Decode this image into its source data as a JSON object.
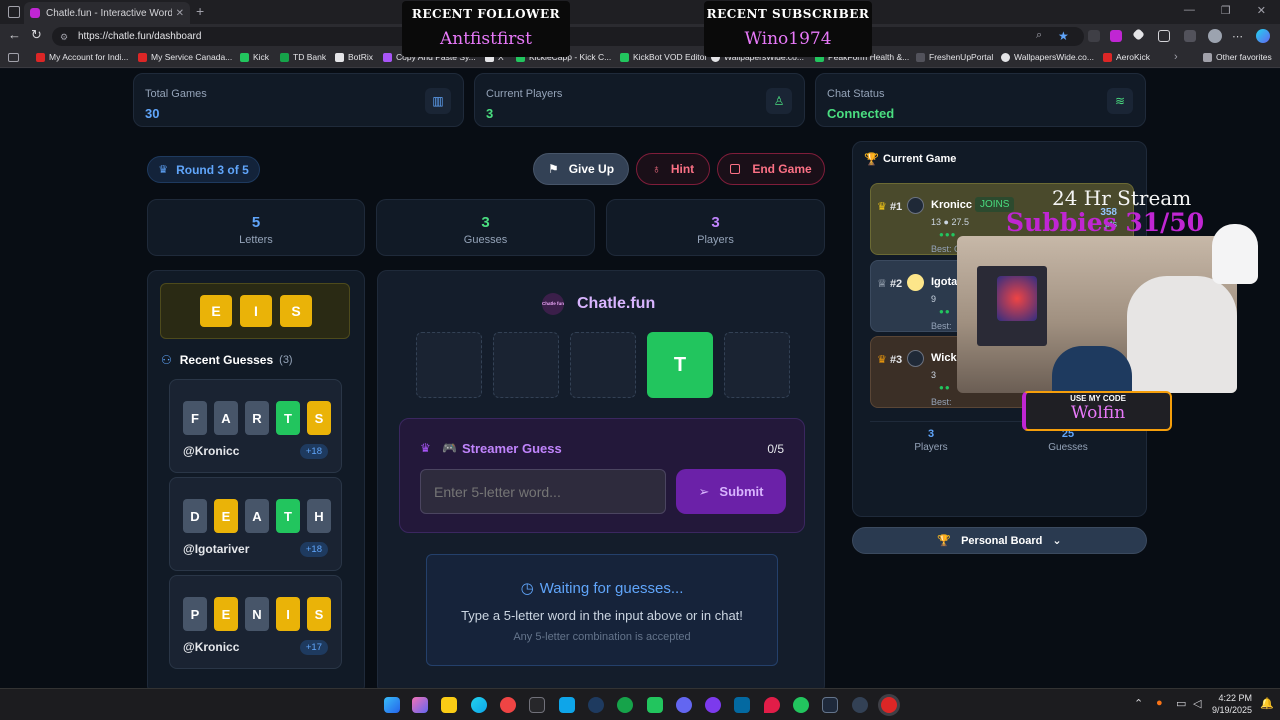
{
  "browser": {
    "tab_title": "Chatle.fun - Interactive Wordle G...",
    "url": "https://chatle.fun/dashboard",
    "bookmarks": [
      "My Account for Indi...",
      "My Service Canada...",
      "Kick",
      "TD Bank",
      "BotRix",
      "Copy And Paste Sy...",
      "X",
      "KickieCapp - Kick C...",
      "KickBot VOD Editor",
      "WallpapersWide.co...",
      "PeakForm Health &...",
      "FreshenUpPortal",
      "WallpapersWide.co...",
      "AeroKick"
    ],
    "other_favorites": "Other favorites"
  },
  "stream_overlay": {
    "follower_heading": "RECENT FOLLOWER",
    "follower_name": "Antfistfirst",
    "subscriber_heading": "RECENT SUBSCRIBER",
    "subscriber_name": "Wino1974",
    "stream_title": "24 Hr Stream",
    "subbies": "Subbies 31/50",
    "code_heading": "USE MY CODE",
    "code_value": "Wolfin"
  },
  "stats": {
    "total_games_label": "Total Games",
    "total_games_value": "30",
    "current_players_label": "Current Players",
    "current_players_value": "3",
    "chat_status_label": "Chat Status",
    "chat_status_value": "Connected"
  },
  "round": {
    "label": "Round 3 of 5"
  },
  "actions": {
    "give_up": "Give Up",
    "hint": "Hint",
    "end_game": "End Game"
  },
  "metrics": [
    {
      "value": "5",
      "label": "Letters"
    },
    {
      "value": "3",
      "label": "Guesses"
    },
    {
      "value": "3",
      "label": "Players"
    }
  ],
  "known_letters": [
    "E",
    "I",
    "S"
  ],
  "recent_guesses": {
    "title": "Recent Guesses",
    "count": "(3)",
    "items": [
      {
        "letters": [
          "F",
          "A",
          "R",
          "T",
          "S"
        ],
        "states": [
          "gray",
          "gray",
          "gray",
          "green",
          "yellow"
        ],
        "user": "@Kronicc",
        "points": "+18"
      },
      {
        "letters": [
          "D",
          "E",
          "A",
          "T",
          "H"
        ],
        "states": [
          "gray",
          "yellow",
          "gray",
          "green",
          "gray"
        ],
        "user": "@Igotariver",
        "points": "+18"
      },
      {
        "letters": [
          "P",
          "E",
          "N",
          "I",
          "S"
        ],
        "states": [
          "gray",
          "yellow",
          "gray",
          "yellow",
          "yellow"
        ],
        "user": "@Kronicc",
        "points": "+17"
      }
    ]
  },
  "board": {
    "brand": "Chatle.fun",
    "logo_text": "Chatle fun",
    "slots": [
      "",
      "",
      "",
      "T",
      ""
    ],
    "streamer_guess_title": "Streamer Guess",
    "streamer_guess_count": "0/5",
    "input_placeholder": "Enter 5-letter word...",
    "submit": "Submit",
    "waiting_title": "Waiting for guesses...",
    "waiting_text": "Type a 5-letter word in the input above or in chat!",
    "waiting_sub": "Any 5-letter combination is accepted"
  },
  "current_game": {
    "title": "Current Game",
    "players": [
      {
        "rank": "#1",
        "name": "Kronicc",
        "badge": "JOINS",
        "meta": "13 ● 27.5",
        "score": "358",
        "score_label": "pts",
        "best": "Best: GAINS (28.1%)"
      },
      {
        "rank": "#2",
        "name": "Igota",
        "meta": "9",
        "best": "Best:"
      },
      {
        "rank": "#3",
        "name": "Wick",
        "meta": "3",
        "best": "Best:"
      }
    ],
    "summary_players_value": "3",
    "summary_players_label": "Players",
    "summary_guesses_value": "25",
    "summary_guesses_label": "Guesses"
  },
  "personal_board": {
    "label": "Personal Board"
  },
  "taskbar": {
    "time": "4:22 PM",
    "date": "9/19/2025"
  }
}
